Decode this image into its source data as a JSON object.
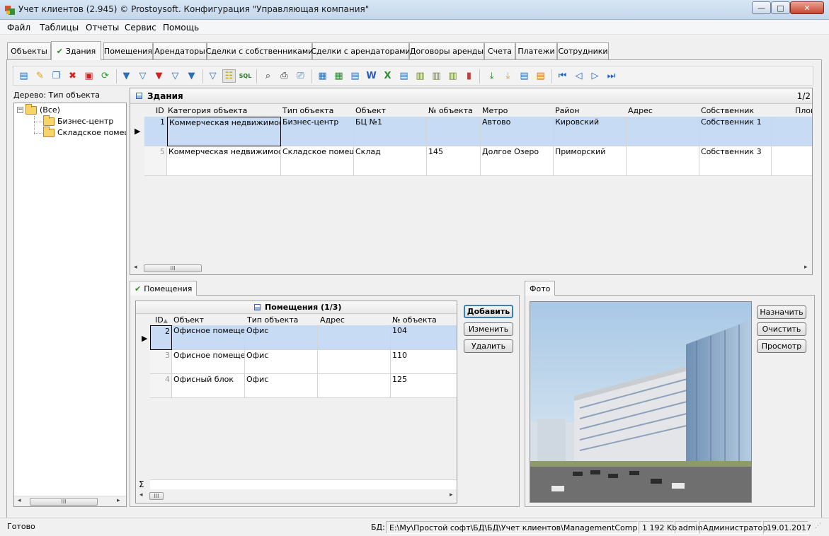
{
  "window": {
    "title": "Учет клиентов (2.945) © Prostoysoft. Конфигурация \"Управляющая компания\"",
    "min_glyph": "—",
    "max_glyph": "□",
    "close_glyph": "✕"
  },
  "menu": [
    "Файл",
    "Таблицы",
    "Отчеты",
    "Сервис",
    "Помощь"
  ],
  "main_tabs": [
    "Объекты",
    "Здания",
    "Помещения",
    "Арендаторы",
    "Сделки с собственниками",
    "Сделки с арендаторами",
    "Договоры аренды",
    "Счета",
    "Платежи",
    "Сотрудники"
  ],
  "active_tab_index": 1,
  "check_mark": "✔",
  "tree": {
    "caption": "Дерево: Тип объекта",
    "expander": "−",
    "root": "(Все)",
    "children": [
      "Бизнес-центр",
      "Складское помещение"
    ]
  },
  "buildings": {
    "title": "Здания",
    "counter": "1/2",
    "columns": [
      "ID",
      "Категория объекта",
      "Тип объекта",
      "Объект",
      "№ объекта",
      "Метро",
      "Район",
      "Адрес",
      "Собственник",
      "Площ"
    ],
    "rows": [
      [
        "1",
        "Коммерческая недвижимость",
        "Бизнес-центр",
        "БЦ №1",
        "",
        "Автово",
        "Кировский",
        "",
        "Собственник 1",
        ""
      ],
      [
        "5",
        "Коммерческая недвижимость",
        "Складское помещение",
        "Склад",
        "145",
        "Долгое Озеро",
        "Приморский",
        "",
        "Собственник 3",
        ""
      ]
    ],
    "selected_row": 0
  },
  "rooms": {
    "tab_label": "Помещения",
    "title": "Помещения (1/3)",
    "columns": [
      "ID",
      "Объект",
      "Тип объекта",
      "Адрес",
      "№ объекта"
    ],
    "rows": [
      [
        "2",
        "Офисное помещение",
        "Офис",
        "",
        "104"
      ],
      [
        "3",
        "Офисное помещение",
        "Офис",
        "",
        "110"
      ],
      [
        "4",
        "Офисный блок",
        "Офис",
        "",
        "125"
      ]
    ],
    "sum_glyph": "Σ",
    "buttons": {
      "add": "Добавить",
      "edit": "Изменить",
      "delete": "Удалить"
    }
  },
  "photo": {
    "tab_label": "Фото",
    "buttons": {
      "assign": "Назначить",
      "clear": "Очистить",
      "view": "Просмотр"
    }
  },
  "scroll": {
    "thumb_grip": "III",
    "left_arrow": "◂",
    "right_arrow": "▸"
  },
  "row_marker": "▶",
  "status": {
    "ready": "Готово",
    "db_label": "БД:",
    "db_path": "E:\\My\\Простой софт\\БД\\БД\\Учет клиентов\\ManagementCompany.mdb",
    "db_size": "1 192 Kb",
    "user": "admin",
    "role": "Администратор",
    "date": "19.01.2017"
  },
  "colors": {
    "selection": "#c7dbf4",
    "accent": "#3c7fb1",
    "folder": "#f6d469"
  },
  "toolbar_icons": [
    "add-record",
    "edit-pencil",
    "copy",
    "delete-x",
    "delete-all",
    "refresh",
    "filter",
    "filter-remove",
    "filter-clear",
    "filter-edit",
    "filter-apply",
    "find-filter",
    "tree-view",
    "sql",
    "find-binoculars",
    "print",
    "preview",
    "export-word",
    "export-excel",
    "export-html",
    "export-word2",
    "export-excel2",
    "export-xml",
    "export-txt",
    "export-csv",
    "export-sql",
    "chart",
    "import1",
    "import2",
    "import3",
    "import4",
    "first",
    "prev",
    "next",
    "last"
  ]
}
